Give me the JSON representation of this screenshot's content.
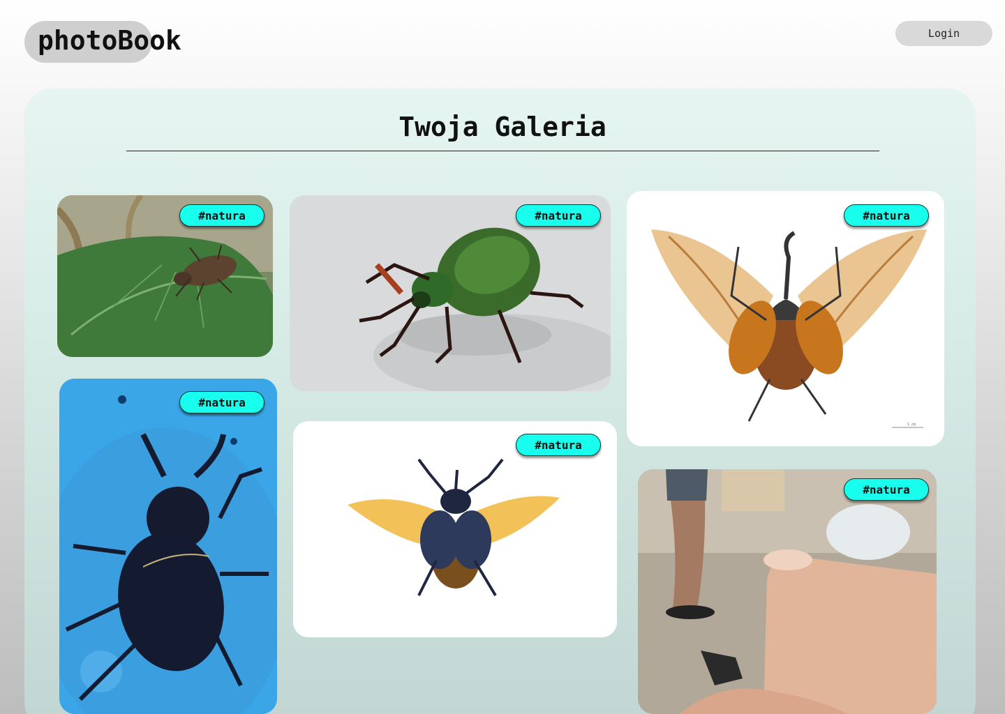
{
  "header": {
    "logo": "photoBook",
    "login_label": "Login"
  },
  "gallery": {
    "title": "Twoja Galeria",
    "photos": [
      {
        "tag": "#natura",
        "subject": "brown beetle on green leaf"
      },
      {
        "tag": "#natura",
        "subject": "green beetle on white surface"
      },
      {
        "tag": "#natura",
        "subject": "rhinoceros beetle with open wings"
      },
      {
        "tag": "#natura",
        "subject": "black stag beetle on blue surface"
      },
      {
        "tag": "#natura",
        "subject": "blue horned beetle with open wings"
      },
      {
        "tag": "#natura",
        "subject": "finger held over wooden deck"
      }
    ]
  },
  "colors": {
    "tag_background": "#19ffee",
    "logo_background": "#cfcfcf",
    "login_background": "#d9d9d9",
    "panel_top": "#e6f5f1",
    "panel_bottom": "#c1d6d2"
  }
}
